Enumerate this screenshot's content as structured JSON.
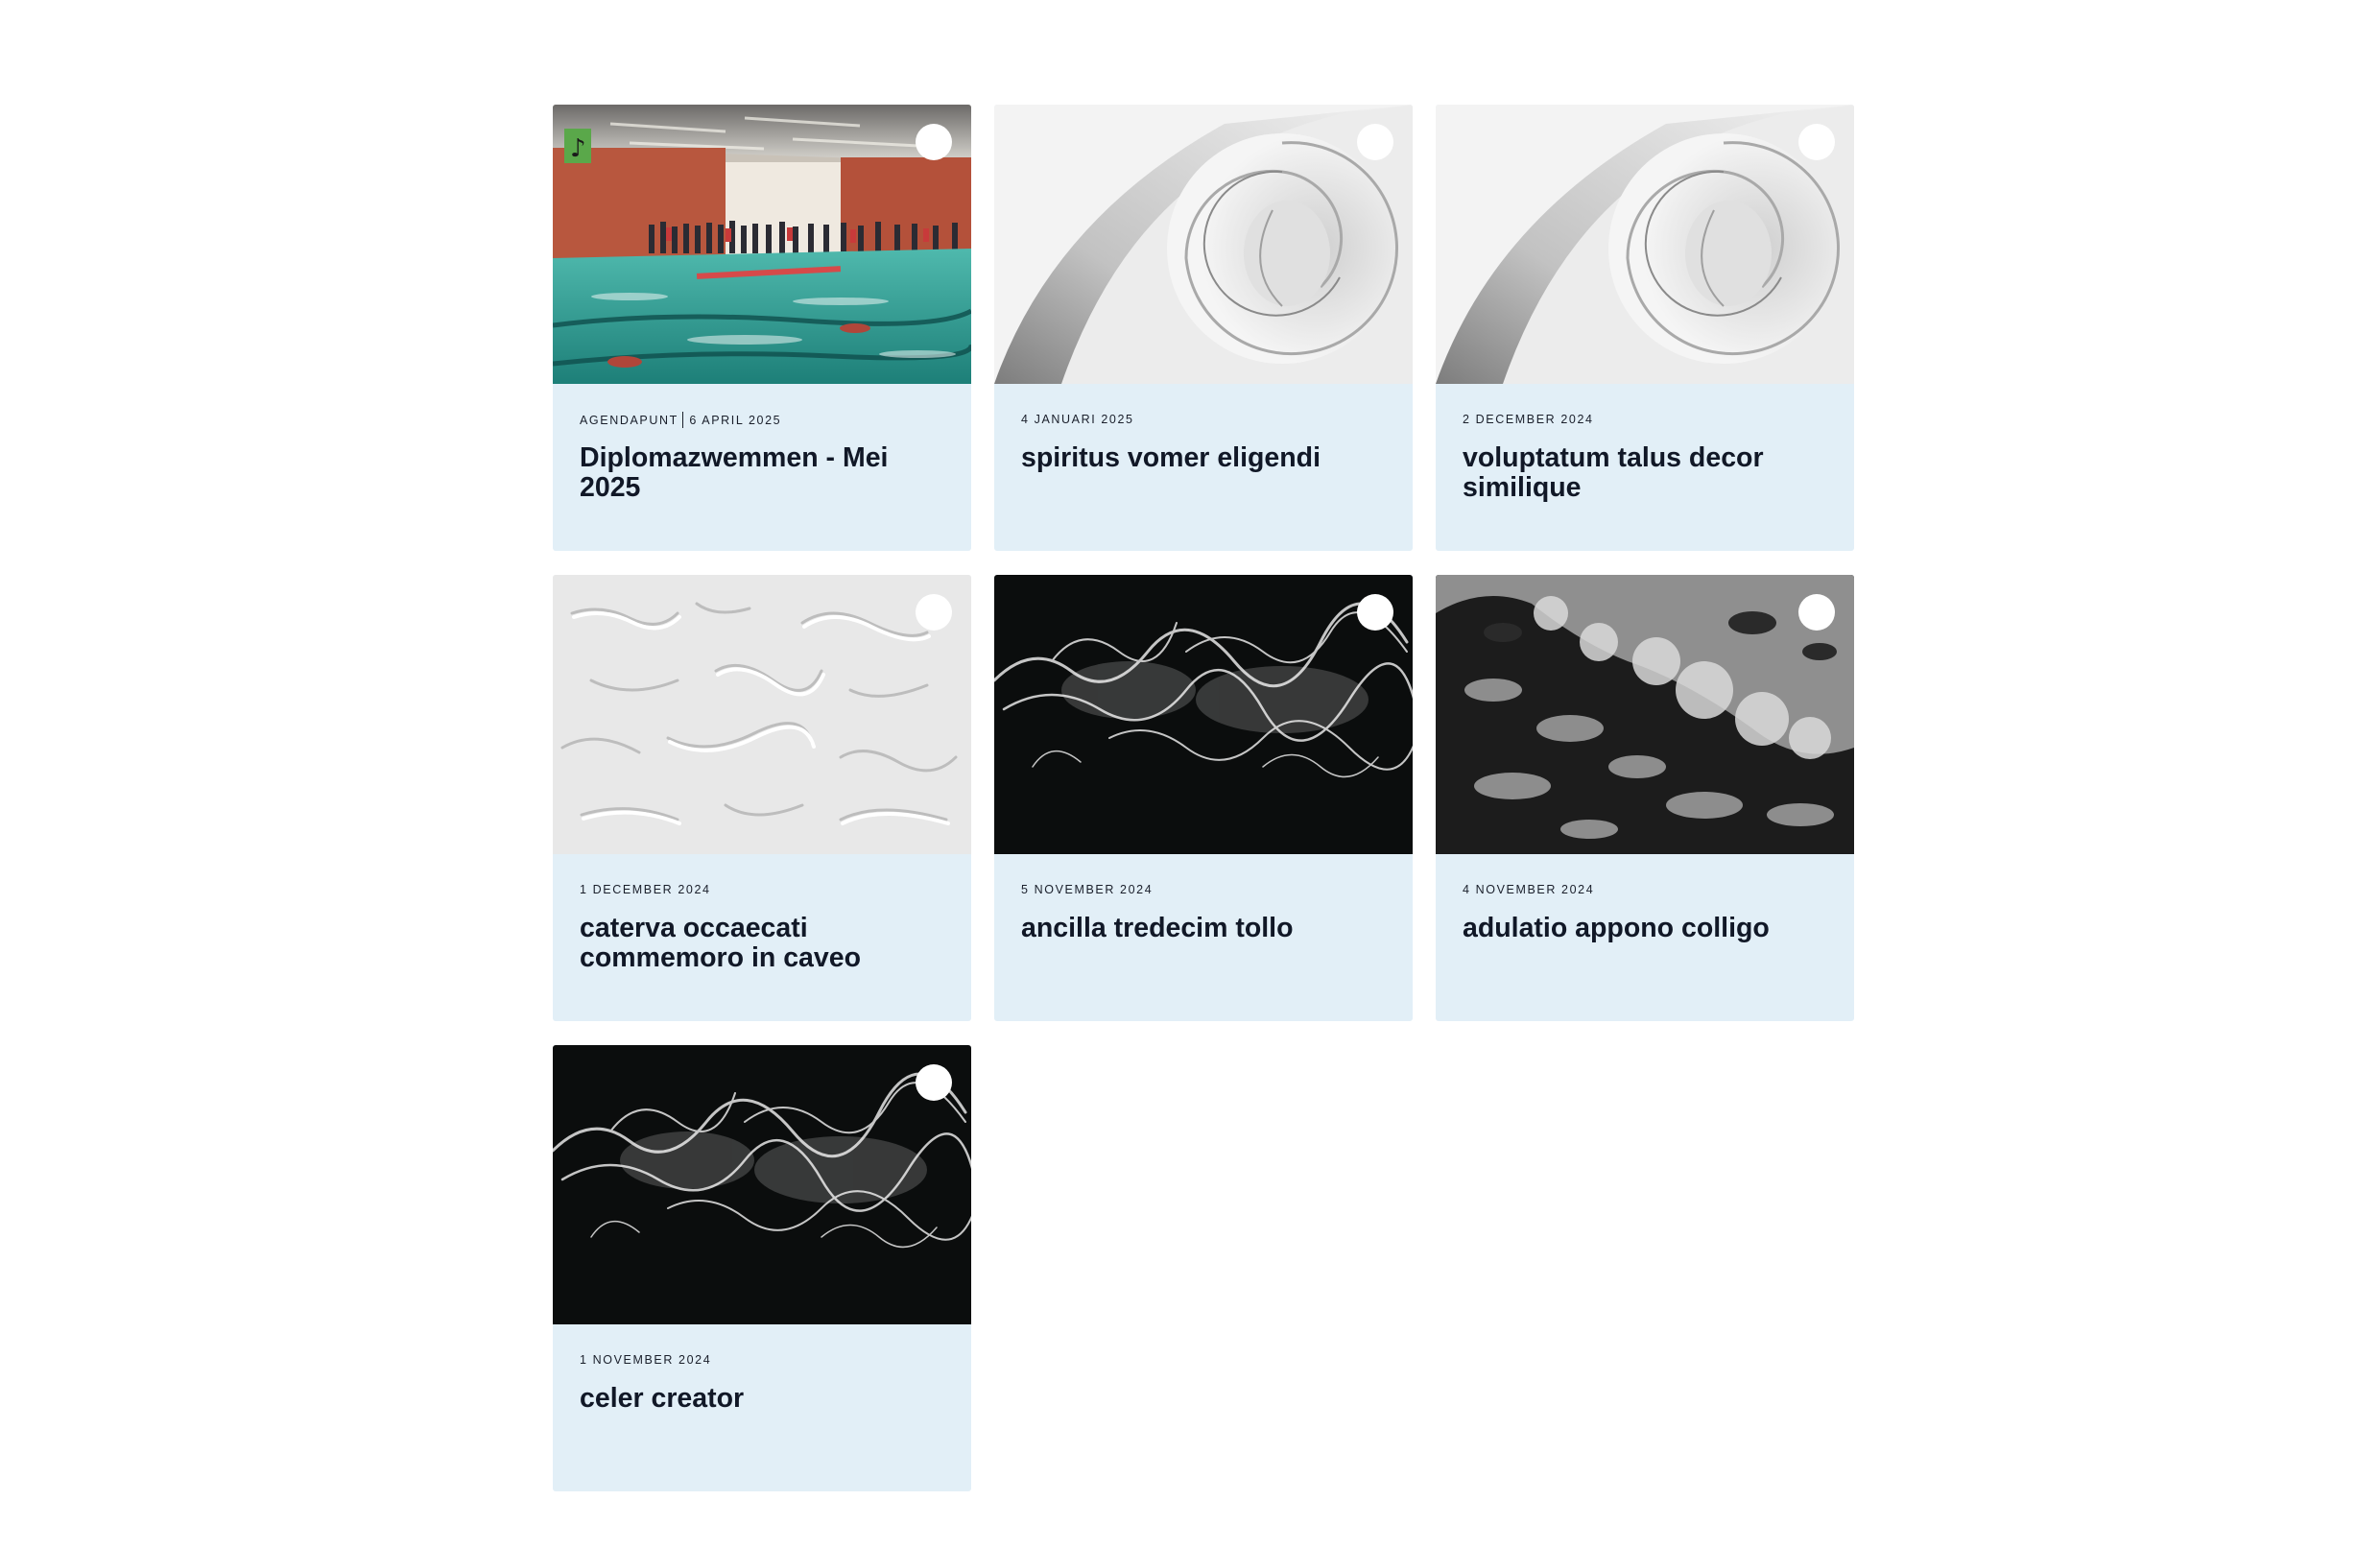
{
  "cards": [
    {
      "image": "indoor-swimming-pool-photo",
      "category": "AGENDAPUNT",
      "date": "6 APRIL 2025",
      "title": "Diplomazwemmen - Mei 2025"
    },
    {
      "image": "white-paper-spiral-photo",
      "category": "",
      "date": "4 JANUARI 2025",
      "title": "spiritus vomer eligendi"
    },
    {
      "image": "white-paper-spiral-photo",
      "category": "",
      "date": "2 DECEMBER 2024",
      "title": "voluptatum talus decor similique"
    },
    {
      "image": "white-plaster-texture-photo",
      "category": "",
      "date": "1 DECEMBER 2024",
      "title": "caterva occaecati commemoro in caveo"
    },
    {
      "image": "white-smoke-on-black-photo",
      "category": "",
      "date": "5 NOVEMBER 2024",
      "title": "ancilla tredecim tollo"
    },
    {
      "image": "ocean-foam-aerial-photo",
      "category": "",
      "date": "4 NOVEMBER 2024",
      "title": "adulatio appono colligo"
    },
    {
      "image": "white-smoke-on-black-photo",
      "category": "",
      "date": "1 NOVEMBER 2024",
      "title": "celer creator"
    }
  ],
  "colors": {
    "card_background": "#e2eff7",
    "text_dark": "#111827"
  }
}
